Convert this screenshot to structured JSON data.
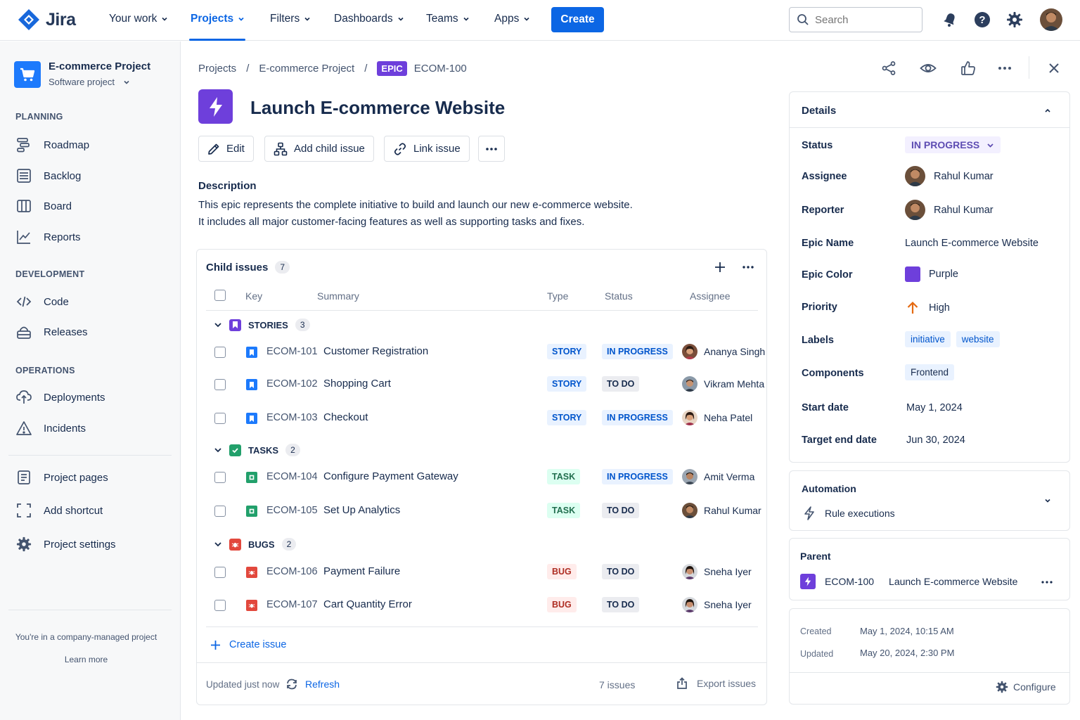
{
  "topnav": {
    "logo_text": "Jira",
    "items": [
      {
        "label": "Your work"
      },
      {
        "label": "Projects"
      },
      {
        "label": "Filters"
      },
      {
        "label": "Dashboards"
      },
      {
        "label": "Teams"
      },
      {
        "label": "Apps"
      }
    ],
    "active_item": "Projects",
    "create_label": "Create",
    "search_placeholder": "Search",
    "icons": [
      "notifications-icon",
      "help-icon",
      "settings-icon",
      "user-avatar"
    ]
  },
  "sidebar": {
    "project_name": "E-commerce Project",
    "project_type": "Software project",
    "sections": [
      {
        "label": "PLANNING",
        "items": [
          {
            "label": "Roadmap",
            "icon": "roadmap-icon"
          },
          {
            "label": "Backlog",
            "icon": "backlog-icon"
          },
          {
            "label": "Board",
            "icon": "board-icon"
          },
          {
            "label": "Reports",
            "icon": "reports-icon"
          }
        ]
      },
      {
        "label": "DEVELOPMENT",
        "items": [
          {
            "label": "Code",
            "icon": "code-icon"
          },
          {
            "label": "Releases",
            "icon": "releases-icon"
          }
        ]
      },
      {
        "label": "OPERATIONS",
        "items": [
          {
            "label": "Deployments",
            "icon": "deployments-icon"
          },
          {
            "label": "Incidents",
            "icon": "incidents-icon"
          }
        ]
      }
    ],
    "extra_items": [
      {
        "label": "Project pages",
        "icon": "pages-icon"
      },
      {
        "label": "Add shortcut",
        "icon": "shortcut-icon"
      },
      {
        "label": "Project settings",
        "icon": "gear-icon"
      }
    ],
    "footer_text": "You're in a company-managed project",
    "footer_link": "Learn more"
  },
  "breadcrumb": {
    "items": [
      "Projects",
      "E-commerce Project"
    ],
    "separator": "/",
    "badge": "EPIC",
    "issue_key": "ECOM-100"
  },
  "issue": {
    "title": "Launch E-commerce Website",
    "actions": [
      "Edit",
      "Add child issue",
      "Link issue"
    ],
    "description_heading": "Description",
    "description_lines": [
      "This epic represents the complete initiative to build and launch our new e-commerce website.",
      "It includes all major customer-facing features as well as supporting tasks and fixes."
    ]
  },
  "child_issues": {
    "title": "Child issues",
    "count": "7",
    "columns": [
      "Key",
      "Summary",
      "Type",
      "Status",
      "Assignee"
    ],
    "groups": [
      {
        "label": "STORIES",
        "count": "3",
        "rows": [
          {
            "key": "ECOM-101",
            "summary": "Customer Registration",
            "type": "STORY",
            "status": "IN PROGRESS",
            "assignee": "Ananya Singh"
          },
          {
            "key": "ECOM-102",
            "summary": "Shopping Cart",
            "type": "STORY",
            "status": "TO DO",
            "assignee": "Vikram Mehta"
          },
          {
            "key": "ECOM-103",
            "summary": "Checkout",
            "type": "STORY",
            "status": "IN PROGRESS",
            "assignee": "Neha Patel"
          }
        ]
      },
      {
        "label": "TASKS",
        "count": "2",
        "rows": [
          {
            "key": "ECOM-104",
            "summary": "Configure Payment Gateway",
            "type": "TASK",
            "status": "IN PROGRESS",
            "assignee": "Amit Verma"
          },
          {
            "key": "ECOM-105",
            "summary": "Set Up Analytics",
            "type": "TASK",
            "status": "TO DO",
            "assignee": "Rahul Kumar"
          }
        ]
      },
      {
        "label": "BUGS",
        "count": "2",
        "rows": [
          {
            "key": "ECOM-106",
            "summary": "Payment Failure",
            "type": "BUG",
            "status": "TO DO",
            "assignee": "Sneha Iyer"
          },
          {
            "key": "ECOM-107",
            "summary": "Cart Quantity Error",
            "type": "BUG",
            "status": "TO DO",
            "assignee": "Sneha Iyer"
          }
        ]
      }
    ],
    "create_label": "Create issue",
    "updated_text": "Updated just now",
    "refresh_label": "Refresh",
    "issues_count": "7 issues",
    "export_label": "Export issues"
  },
  "details": {
    "heading": "Details",
    "status_label": "Status",
    "status_value": "IN PROGRESS",
    "assignee_label": "Assignee",
    "assignee_value": "Rahul Kumar",
    "reporter_label": "Reporter",
    "reporter_value": "Rahul Kumar",
    "epic_name_label": "Epic Name",
    "epic_name_value": "Launch E-commerce Website",
    "epic_color_label": "Epic Color",
    "epic_color_value": "Purple",
    "epic_color_hex": "#6E3FDB",
    "priority_label": "Priority",
    "priority_value": "High",
    "priority_color": "#E2483D",
    "labels_label": "Labels",
    "labels": [
      "initiative",
      "website"
    ],
    "components_label": "Components",
    "components": [
      "Frontend"
    ],
    "start_label": "Start date",
    "start_value": "May 1, 2024",
    "end_label": "Target end date",
    "end_value": "Jun 30, 2024"
  },
  "automation": {
    "heading": "Automation",
    "item": "Rule executions"
  },
  "parent": {
    "heading": "Parent",
    "key": "ECOM-100",
    "title": "Launch E-commerce Website"
  },
  "meta": {
    "created_label": "Created",
    "created_value": "May 1, 2024, 10:15 AM",
    "updated_label": "Updated",
    "updated_value": "May 20, 2024, 2:30 PM",
    "configure_label": "Configure"
  },
  "colors": {
    "brand": "#0C66E4",
    "epic": "#6E3FDB",
    "story": "#1D7AFC",
    "task": "#22A06B",
    "bug": "#E2483D"
  }
}
